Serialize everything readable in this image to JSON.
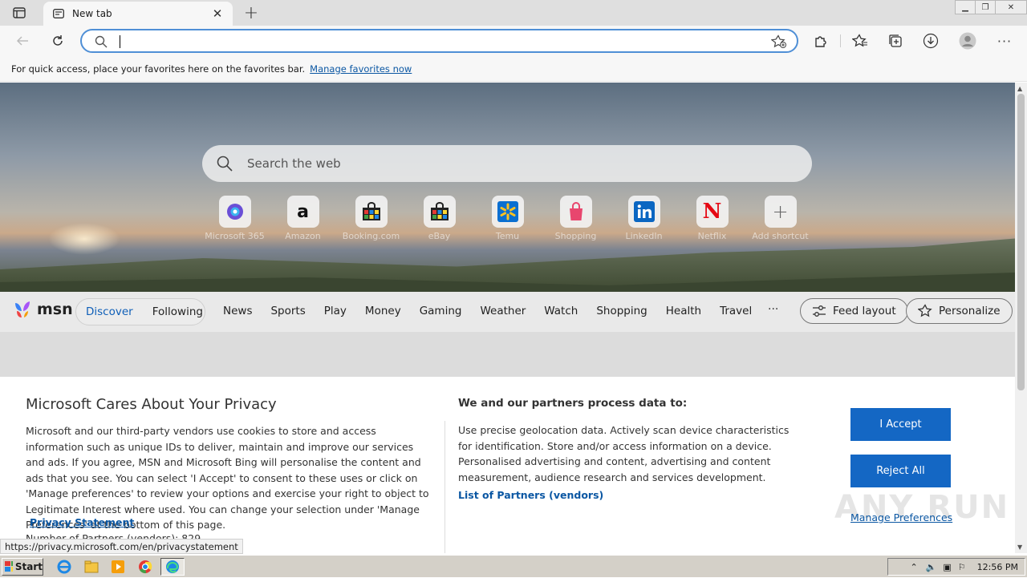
{
  "browser": {
    "tab_title": "New tab",
    "address_value": "",
    "favorites_bar_text": "For quick access, place your favorites here on the favorites bar.",
    "favorites_bar_link": "Manage favorites now"
  },
  "newtab": {
    "search_placeholder": "Search the web",
    "shortcuts": [
      {
        "label": "Microsoft 365",
        "icon": "microsoft365-icon"
      },
      {
        "label": "Amazon",
        "icon": "amazon-icon"
      },
      {
        "label": "Booking.com",
        "icon": "booking-icon"
      },
      {
        "label": "eBay",
        "icon": "ebay-icon"
      },
      {
        "label": "Temu",
        "icon": "walmart-icon"
      },
      {
        "label": "Shopping",
        "icon": "shopping-bag-icon"
      },
      {
        "label": "LinkedIn",
        "icon": "linkedin-icon"
      },
      {
        "label": "Netflix",
        "icon": "netflix-icon"
      },
      {
        "label": "Add shortcut",
        "icon": "plus-icon"
      }
    ]
  },
  "msn": {
    "logo": "msn",
    "discover": "Discover",
    "following": "Following",
    "nav": [
      "News",
      "Sports",
      "Play",
      "Money",
      "Gaming",
      "Weather",
      "Watch",
      "Shopping",
      "Health",
      "Travel"
    ],
    "more": "···",
    "feed_layout": "Feed layout",
    "personalize": "Personalize"
  },
  "privacy": {
    "title": "Microsoft Cares About Your Privacy",
    "body": "Microsoft and our third-party vendors use cookies to store and access information such as unique IDs to deliver, maintain and improve our services and ads. If you agree, MSN and Microsoft Bing will personalise the content and ads that you see. You can select 'I Accept' to consent to these uses or click on 'Manage preferences' to review your options and exercise your right to object to Legitimate Interest where used.  You can change your selection under 'Manage Preferences' at the bottom of this page.",
    "privacy_link": "Privacy Statement",
    "partners_count": "Number of Partners (vendors): 829",
    "right_title": "We and our partners process data to:",
    "right_body": "Use precise geolocation data. Actively scan device characteristics for identification. Store and/or access information on a device. Personalised advertising and content, advertising and content measurement, audience research and services development.",
    "vendors_link": "List of Partners (vendors)",
    "accept": "I Accept",
    "reject": "Reject All",
    "manage": "Manage Preferences"
  },
  "status_url": "https://privacy.microsoft.com/en/privacystatement",
  "taskbar": {
    "start": "Start",
    "clock": "12:56 PM"
  },
  "watermark": "ANY RUN",
  "colors": {
    "accent": "#1467c4",
    "link": "#0b57a3",
    "omnibox_focus": "#4f8fd6"
  }
}
